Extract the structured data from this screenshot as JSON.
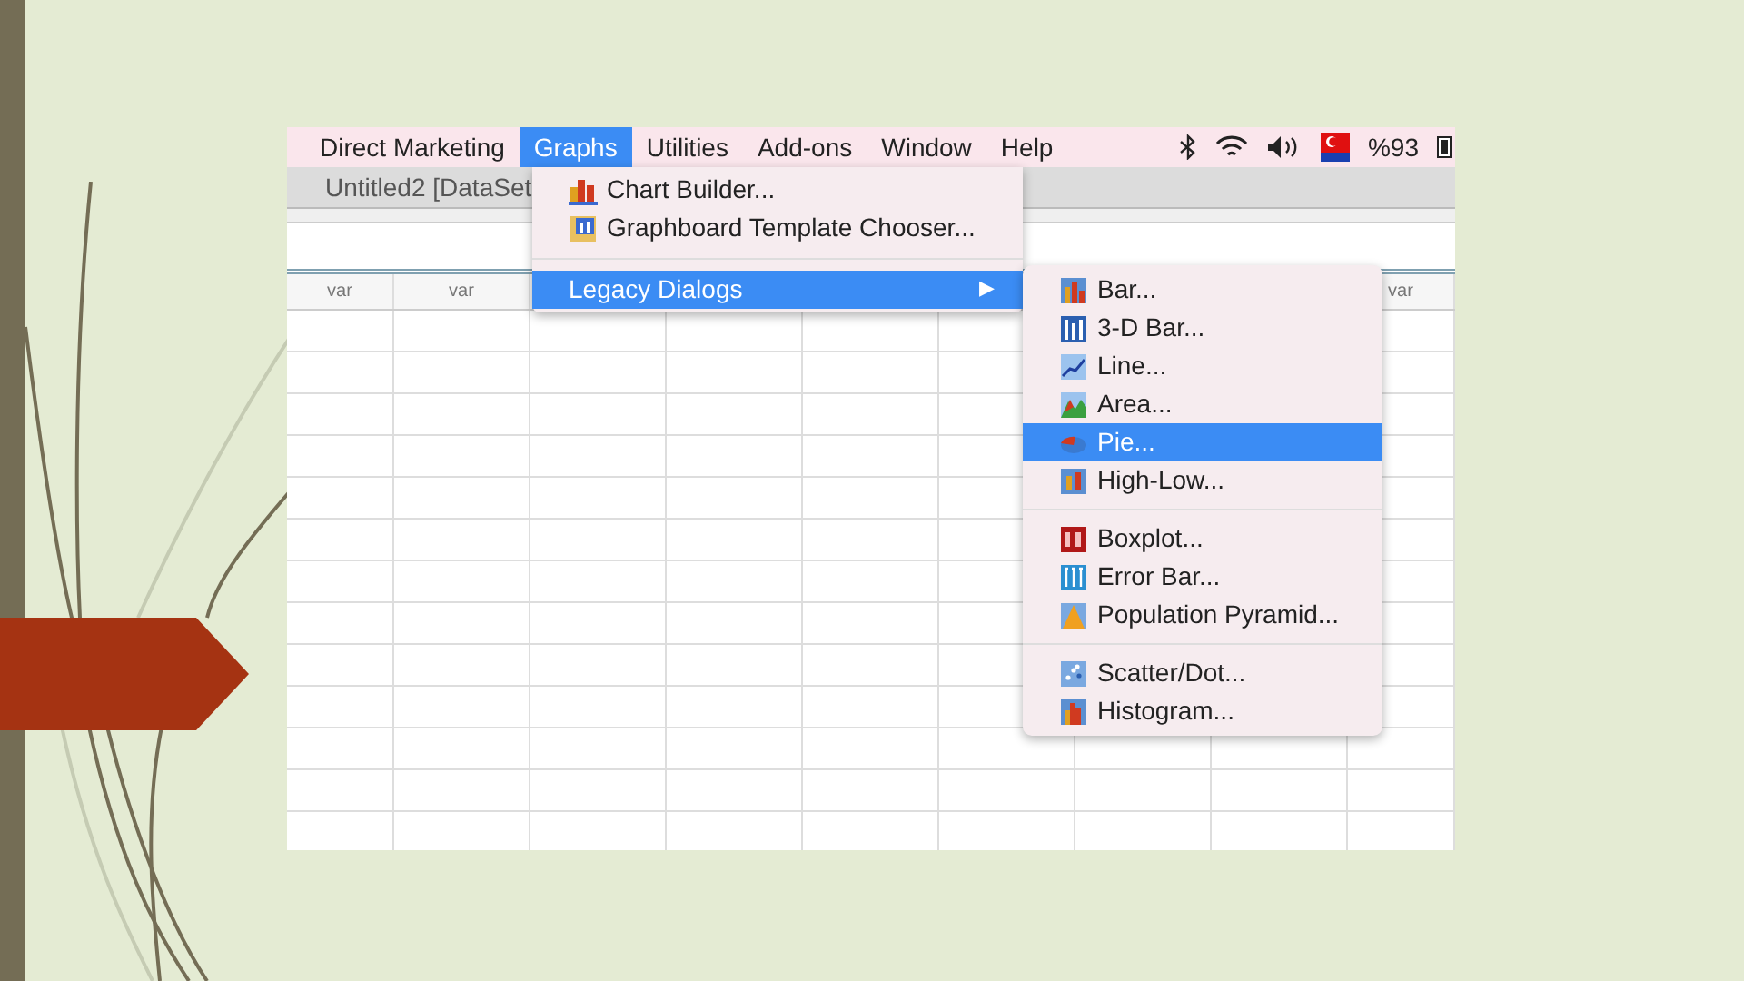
{
  "menu_bar": {
    "items": [
      {
        "label": "Direct Marketing",
        "selected": false
      },
      {
        "label": "Graphs",
        "selected": true
      },
      {
        "label": "Utilities",
        "selected": false
      },
      {
        "label": "Add-ons",
        "selected": false
      },
      {
        "label": "Window",
        "selected": false
      },
      {
        "label": "Help",
        "selected": false
      }
    ],
    "battery_text": "%93"
  },
  "window": {
    "title": "Untitled2 [DataSet"
  },
  "grid": {
    "headers_left": [
      "var",
      "var"
    ],
    "headers_right": [
      "var"
    ]
  },
  "graphs_menu": {
    "groups": [
      [
        {
          "label": "Chart Builder...",
          "selected": false
        },
        {
          "label": "Graphboard Template Chooser...",
          "selected": false
        }
      ],
      [
        {
          "label": "Legacy Dialogs",
          "selected": true,
          "submenu_arrow": "▶"
        }
      ]
    ]
  },
  "legacy_submenu": {
    "groups": [
      [
        {
          "label": "Bar...",
          "selected": false
        },
        {
          "label": "3-D Bar...",
          "selected": false
        },
        {
          "label": "Line...",
          "selected": false
        },
        {
          "label": "Area...",
          "selected": false
        },
        {
          "label": "Pie...",
          "selected": true
        },
        {
          "label": "High-Low...",
          "selected": false
        }
      ],
      [
        {
          "label": "Boxplot...",
          "selected": false
        },
        {
          "label": "Error Bar...",
          "selected": false
        },
        {
          "label": "Population Pyramid...",
          "selected": false
        }
      ],
      [
        {
          "label": "Scatter/Dot...",
          "selected": false
        },
        {
          "label": "Histogram...",
          "selected": false
        }
      ]
    ]
  }
}
